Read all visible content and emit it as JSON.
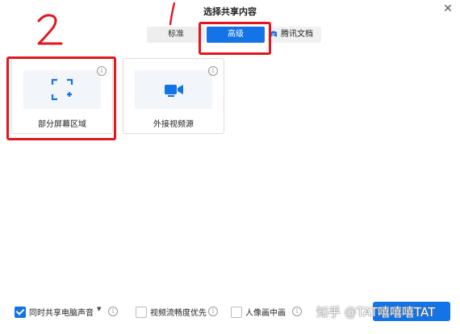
{
  "dialog": {
    "title": "选择共享内容",
    "close_icon": "close-icon"
  },
  "tabs": [
    {
      "label": "标准",
      "selected": false
    },
    {
      "label": "高级",
      "selected": true
    },
    {
      "label": "腾讯文档",
      "selected": false,
      "icon": "tencent-docs-icon"
    }
  ],
  "options": [
    {
      "label": "部分屏幕区域",
      "icon": "region-select-icon"
    },
    {
      "label": "外接视频源",
      "icon": "video-camera-icon"
    }
  ],
  "bottom": {
    "share_audio": {
      "label": "同时共享电脑声音",
      "checked": true
    },
    "video_smooth": {
      "label": "视频流畅度优先",
      "checked": false
    },
    "portrait": {
      "label": "人像画中画",
      "checked": false
    }
  },
  "annotations": [
    "1",
    "2"
  ],
  "watermark": "知乎 @TAT嘻嘻嘻TAT",
  "colors": {
    "accent": "#1473e6",
    "annotation": "#e3161f"
  }
}
